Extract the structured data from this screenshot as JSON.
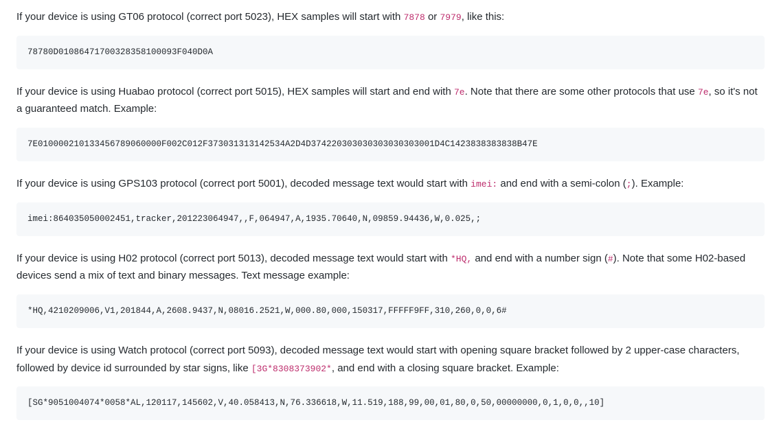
{
  "p1": {
    "a": "If your device is using GT06 protocol (correct port 5023), HEX samples will start with ",
    "c1": "7878",
    "b": " or ",
    "c2": "7979",
    "c": ", like this:"
  },
  "block1": "78780D01086471700328358100093F040D0A",
  "p2": {
    "a": "If your device is using Huabao protocol (correct port 5015), HEX samples will start and end with ",
    "c1": "7e",
    "b": ". Note that there are some other protocols that use ",
    "c2": "7e",
    "c": ", so it's not a guaranteed match. Example:"
  },
  "block2": "7E010000210133456789060000F002C012F373031313142534A2D4D374220303030303030303001D4C1423838383838B47E",
  "p3": {
    "a": "If your device is using GPS103 protocol (correct port 5001), decoded message text would start with ",
    "c1": "imei:",
    "b": " and end with a semi-colon (",
    "c2": ";",
    "c": "). Example:"
  },
  "block3": "imei:864035050002451,tracker,201223064947,,F,064947,A,1935.70640,N,09859.94436,W,0.025,;",
  "p4": {
    "a": "If your device is using H02 protocol (correct port 5013), decoded message text would start with ",
    "c1": "*HQ,",
    "b": " and end with a number sign (",
    "c2": "#",
    "c": "). Note that some H02-based devices send a mix of text and binary messages. Text message example:"
  },
  "block4": "*HQ,4210209006,V1,201844,A,2608.9437,N,08016.2521,W,000.80,000,150317,FFFFF9FF,310,260,0,0,6#",
  "p5": {
    "a": "If your device is using Watch protocol (correct port 5093), decoded message text would start with opening square bracket followed by 2 upper-case characters, followed by device id surrounded by star signs, like ",
    "c1": "[3G*8308373902*",
    "b": ", and end with a closing square bracket. Example:"
  },
  "block5": "[SG*9051004074*0058*AL,120117,145602,V,40.058413,N,76.336618,W,11.519,188,99,00,01,80,0,50,00000000,0,1,0,0,,10]"
}
